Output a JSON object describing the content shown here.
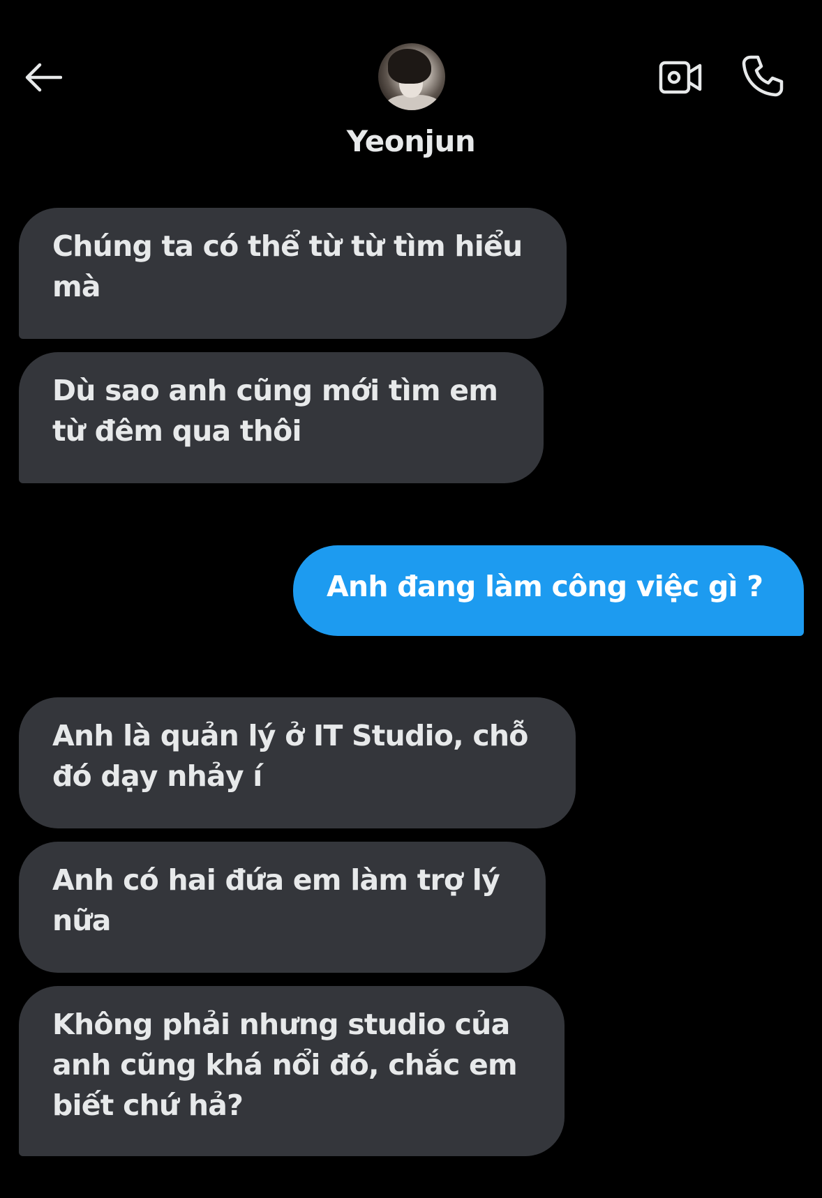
{
  "header": {
    "contact_name": "Yeonjun",
    "back_icon": "arrow-left-icon",
    "video_icon": "video-camera-icon",
    "call_icon": "phone-icon"
  },
  "messages": [
    {
      "direction": "received",
      "text": "Chúng ta có thể từ từ tìm hiểu mà"
    },
    {
      "direction": "received",
      "text": "Dù sao anh cũng mới tìm em từ đêm qua thôi"
    },
    {
      "direction": "sent",
      "text": "Anh đang làm công việc gì ?"
    },
    {
      "direction": "received",
      "text": "Anh là quản lý ở IT Studio, chỗ đó dạy nhảy í"
    },
    {
      "direction": "received",
      "text": "Anh có hai đứa em làm trợ lý nữa"
    },
    {
      "direction": "received",
      "text": "Không phải nhưng studio của anh cũng khá nổi đó, chắc em biết chứ hả?"
    }
  ],
  "colors": {
    "background": "#000000",
    "received_bubble": "#34363b",
    "sent_bubble": "#1d9bf0",
    "text": "#e7e9ea"
  }
}
